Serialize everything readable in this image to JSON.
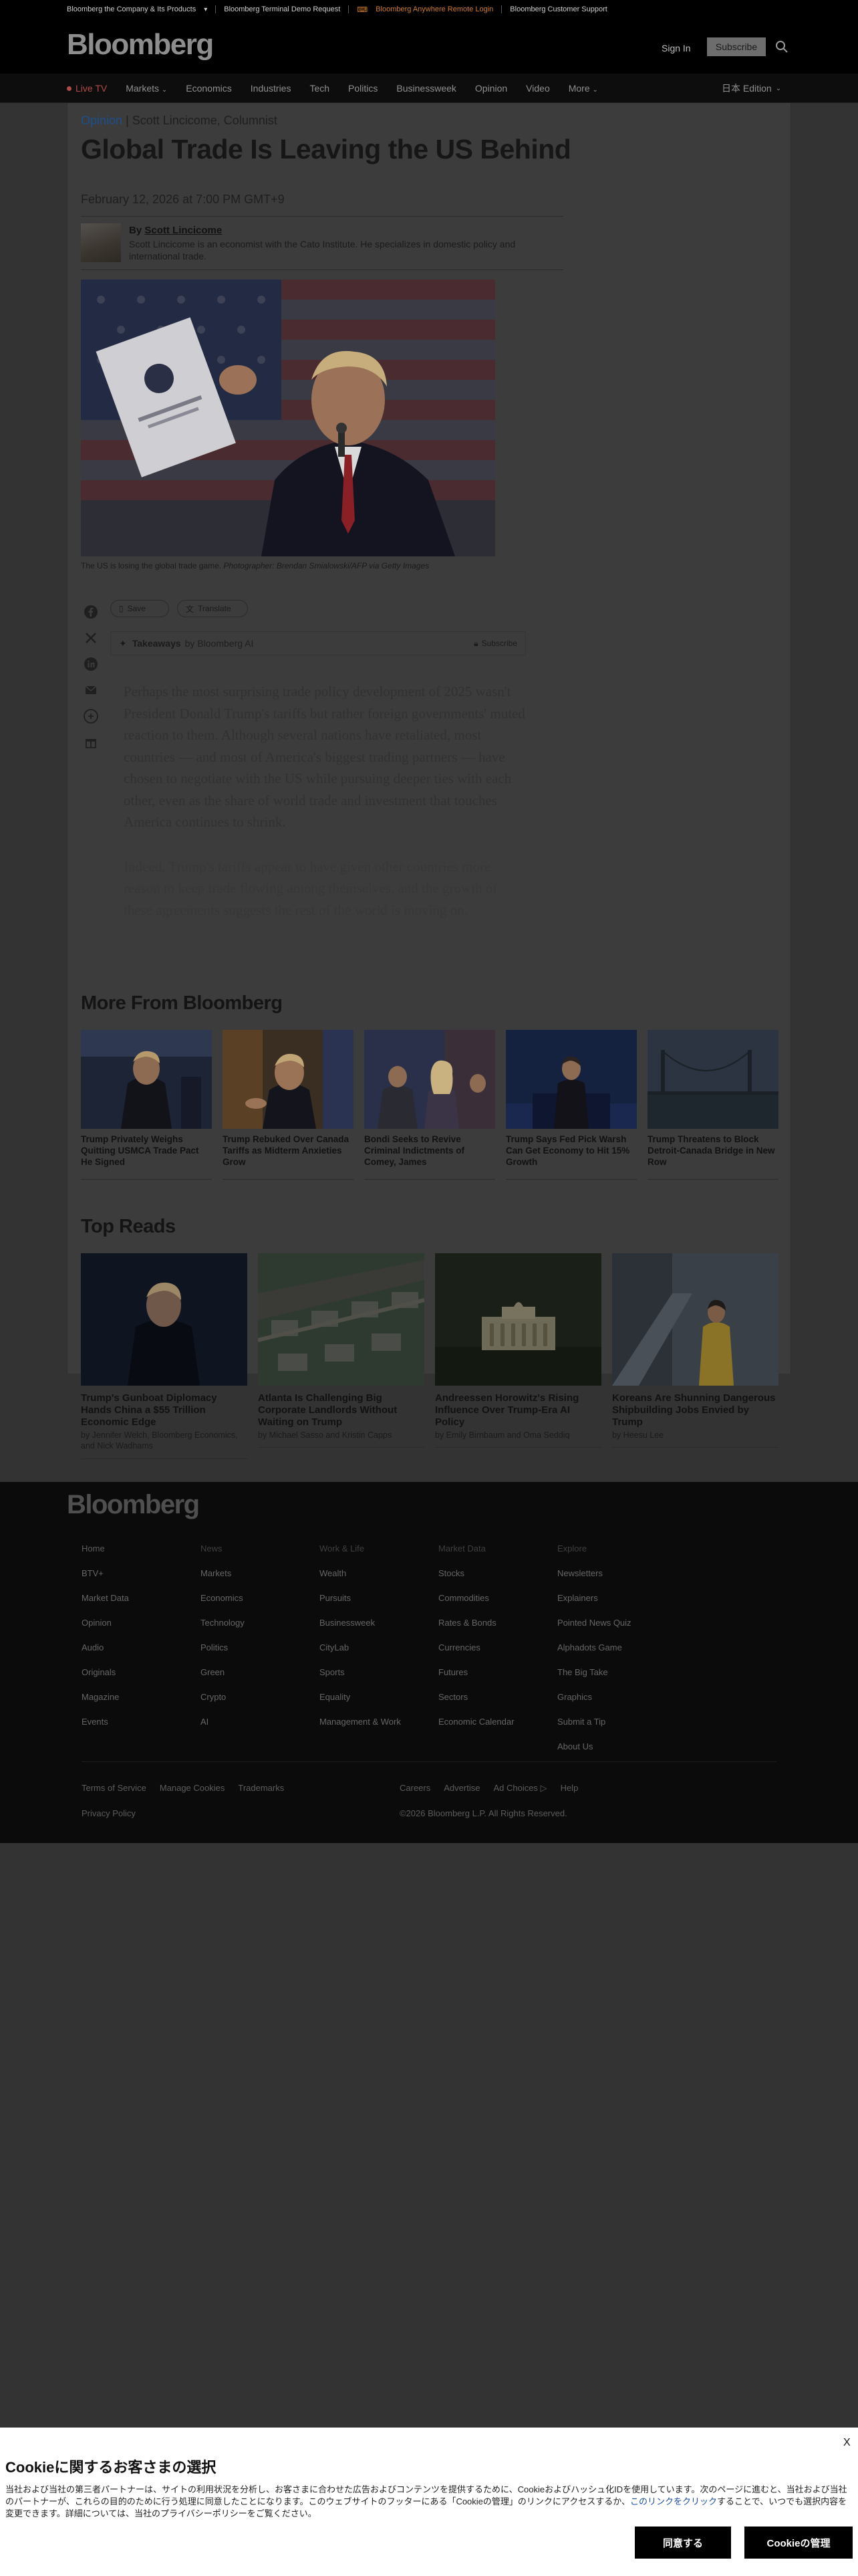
{
  "utility_bar": {
    "items": [
      "Bloomberg the Company & Its Products",
      "Bloomberg Terminal Demo Request",
      "Bloomberg Anywhere Remote Login",
      "Bloomberg Customer Support"
    ]
  },
  "header": {
    "logo": "Bloomberg",
    "sign_in": "Sign In",
    "subscribe": "Subscribe"
  },
  "nav": {
    "live": "Live TV",
    "items": [
      "Markets",
      "Economics",
      "Industries",
      "Tech",
      "Politics",
      "Businessweek",
      "Opinion",
      "Video",
      "More"
    ],
    "edition": "日本 Edition"
  },
  "article": {
    "section": "Opinion",
    "kicker_author": "Scott Lincicome, Columnist",
    "headline": "Global Trade Is Leaving the US Behind",
    "date": "February 12, 2026 at 7:00 PM GMT+9",
    "by_prefix": "By",
    "author_name": "Scott Lincicome",
    "author_bio": "Scott Lincicome is an economist with the Cato Institute. He specializes in domestic policy and international trade.",
    "caption_main": "The US is losing the global trade game.",
    "caption_credit": "Photographer: Brendan Smialowski/AFP via Getty Images",
    "save": "Save",
    "translate": "Translate",
    "takeaways_label": "Takeaways",
    "takeaways_by": "by Bloomberg AI",
    "takeaways_subscribe": "Subscribe",
    "paragraphs": [
      "Perhaps the most surprising trade policy development of 2025 wasn't President Donald Trump's tariffs but rather foreign governments' muted reaction to them. Although several nations have retaliated, most countries — and most of America's biggest trading partners — have chosen to negotiate with the US while pursuing deeper ties with each other, even as the share of world trade and investment that touches America continues to shrink.",
      "Indeed, Trump's tariffs appear to have given other countries more reason to keep trade flowing among themselves, and the growth of these agreements suggests the rest of the world is moving on."
    ]
  },
  "more_from": {
    "title": "More From Bloomberg",
    "items": [
      "Trump Privately Weighs Quitting USMCA Trade Pact He Signed",
      "Trump Rebuked Over Canada Tariffs as Midterm Anxieties Grow",
      "Bondi Seeks to Revive Criminal Indictments of Comey, James",
      "Trump Says Fed Pick Warsh Can Get Economy to Hit 15% Growth",
      "Trump Threatens to Block Detroit-Canada Bridge in New Row"
    ]
  },
  "top_reads": {
    "title": "Top Reads",
    "items": [
      {
        "title": "Trump's Gunboat Diplomacy Hands China a $55 Trillion Economic Edge",
        "byline": "by Jennifer Welch, Bloomberg Economics, and Nick Wadhams"
      },
      {
        "title": "Atlanta Is Challenging Big Corporate Landlords Without Waiting on Trump",
        "byline": "by Michael Sasso and Kristin Capps"
      },
      {
        "title": "Andreessen Horowitz's Rising Influence Over Trump-Era AI Policy",
        "byline": "by Emily Birnbaum and Oma Seddiq"
      },
      {
        "title": "Koreans Are Shunning Dangerous Shipbuilding Jobs Envied by Trump",
        "byline": "by Heesu Lee"
      }
    ]
  },
  "footer": {
    "logo": "Bloomberg",
    "columns": [
      [
        "Home",
        "BTV+",
        "Market Data",
        "Opinion",
        "Audio",
        "Originals",
        "Magazine",
        "Events"
      ],
      [
        "News",
        "Markets",
        "Economics",
        "Technology",
        "Politics",
        "Green",
        "Crypto",
        "AI"
      ],
      [
        "Work & Life",
        "Wealth",
        "Pursuits",
        "Businessweek",
        "CityLab",
        "Sports",
        "Equality",
        "Management & Work"
      ],
      [
        "Market Data",
        "Stocks",
        "Commodities",
        "Rates & Bonds",
        "Currencies",
        "Futures",
        "Sectors",
        "Economic Calendar"
      ],
      [
        "Explore",
        "Newsletters",
        "Explainers",
        "Pointed News Quiz",
        "Alphadots Game",
        "The Big Take",
        "Graphics",
        "Submit a Tip",
        "About Us"
      ]
    ],
    "links_left": [
      "Terms of Service",
      "Manage Cookies",
      "Trademarks"
    ],
    "privacy": "Privacy Policy",
    "links_right": [
      "Careers",
      "Advertise",
      "Ad Choices",
      "Help"
    ],
    "copyright": "©2026 Bloomberg L.P. All Rights Reserved."
  },
  "cookie": {
    "close": "X",
    "title": "Cookieに関するお客さまの選択",
    "body_1": "当社および当社の第三者パートナーは、サイトの利用状況を分析し、お客さまに合わせた広告およびコンテンツを提供するために、Cookieおよびハッシュ化IDを使用しています。次のページに進むと、当社および当社のパートナーが、これらの目的のために行う処理に同意したことになります。このウェブサイトのフッターにある「Cookieの管理」のリンクにアクセスするか、",
    "link": "このリンクをクリック",
    "body_2": "することで、いつでも選択内容を変更できます。詳細については、当社のプライバシーポリシーをご覧ください。",
    "accept": "同意する",
    "manage": "Cookieの管理"
  }
}
